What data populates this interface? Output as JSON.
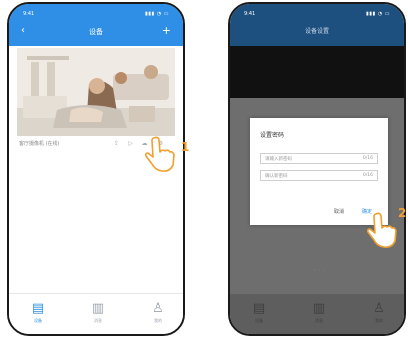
{
  "colors": {
    "accent": "#2f8fe6",
    "step_badge": "#f0a030",
    "overlay": "#6e6e6e"
  },
  "left_phone": {
    "status": {
      "time": "9:41",
      "signals": "▮▮▮ ◔ ▭"
    },
    "header": {
      "title": "设备",
      "back_icon": "back-icon",
      "add_icon": "plus-icon"
    },
    "camera_card": {
      "name": "客厅摄像机 (在线)",
      "actions": [
        "share-icon",
        "playback-icon",
        "cloud-icon",
        "settings-icon"
      ]
    },
    "tabs": [
      {
        "glyph": "▤",
        "label": "设备",
        "active": true
      },
      {
        "glyph": "▥",
        "label": "消息",
        "active": false
      },
      {
        "glyph": "♙",
        "label": "我的",
        "active": false
      }
    ],
    "step_number": "1"
  },
  "right_phone": {
    "status": {
      "time": "9:41",
      "signals": "▮▮▮ ◔ ▭"
    },
    "header": {
      "title": "设备设置"
    },
    "dialog": {
      "title": "设置密码",
      "fields": [
        {
          "placeholder": "请输入新密码",
          "value": "0/16"
        },
        {
          "placeholder": "确认新密码",
          "value": "0/16"
        }
      ],
      "cancel_label": "取消",
      "ok_label": "确定"
    },
    "tabs": [
      {
        "glyph": "▤",
        "label": "设备"
      },
      {
        "glyph": "▥",
        "label": "消息"
      },
      {
        "glyph": "♙",
        "label": "我的"
      }
    ],
    "loading_text": "• • •",
    "step_number": "2"
  }
}
